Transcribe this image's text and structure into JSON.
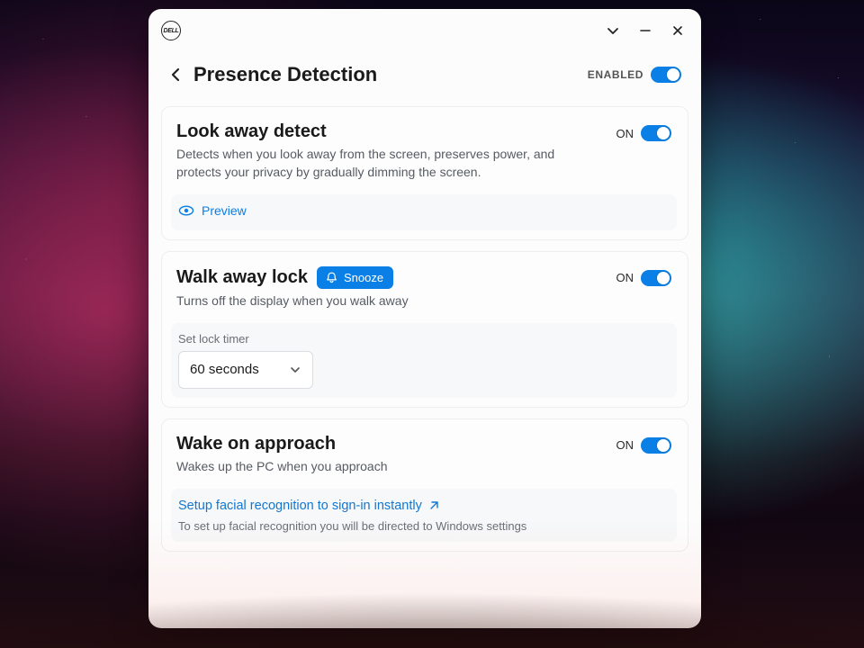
{
  "header": {
    "title": "Presence Detection",
    "enabled_label": "ENABLED",
    "enabled": true
  },
  "look_away": {
    "title": "Look away detect",
    "description": "Detects when you look away from the screen, preserves power, and protects your privacy by gradually dimming the screen.",
    "state_label": "ON",
    "state": true,
    "preview_label": "Preview"
  },
  "walk_away": {
    "title": "Walk away lock",
    "snooze_label": "Snooze",
    "description": "Turns off the display when you walk away",
    "state_label": "ON",
    "state": true,
    "timer_field_label": "Set lock timer",
    "timer_value": "60 seconds"
  },
  "wake": {
    "title": "Wake on approach",
    "description": "Wakes up the PC when you approach",
    "state_label": "ON",
    "state": true,
    "link_label": "Setup facial recognition to sign-in instantly",
    "link_sub": "To set up facial recognition you will be directed to Windows settings"
  }
}
